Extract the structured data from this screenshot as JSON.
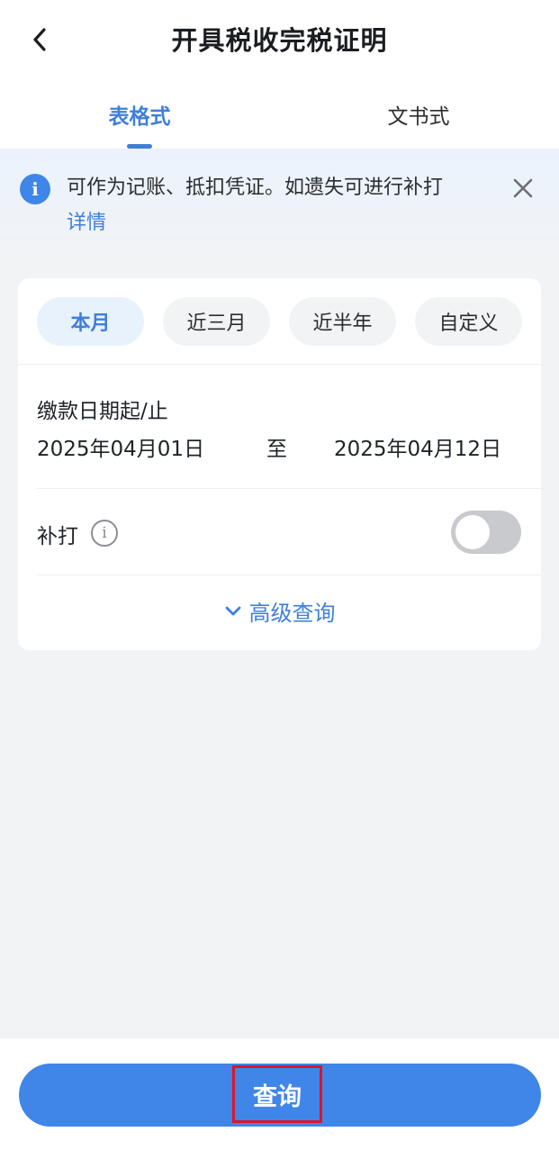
{
  "header": {
    "title": "开具税收完税证明",
    "back_icon": "chevron-left-icon"
  },
  "tabs": [
    {
      "label": "表格式",
      "active": true
    },
    {
      "label": "文书式",
      "active": false
    }
  ],
  "notice": {
    "icon": "info-icon",
    "text": "可作为记账、抵扣凭证。如遗失可进行补打",
    "link": "详情",
    "close_icon": "close-icon"
  },
  "filters": {
    "chips": [
      {
        "label": "本月",
        "active": true
      },
      {
        "label": "近三月",
        "active": false
      },
      {
        "label": "近半年",
        "active": false
      },
      {
        "label": "自定义",
        "active": false
      }
    ]
  },
  "date_range": {
    "label": "缴款日期起/止",
    "start": "2025年04月01日",
    "separator": "至",
    "end": "2025年04月12日"
  },
  "reprint": {
    "label": "补打",
    "info_icon": "info-circle-icon",
    "enabled": false
  },
  "advanced": {
    "label": "高级查询",
    "icon": "chevron-down-icon"
  },
  "query_button": {
    "label": "查询"
  },
  "colors": {
    "accent": "#3f86e8",
    "highlight_box": "#d9162b"
  }
}
